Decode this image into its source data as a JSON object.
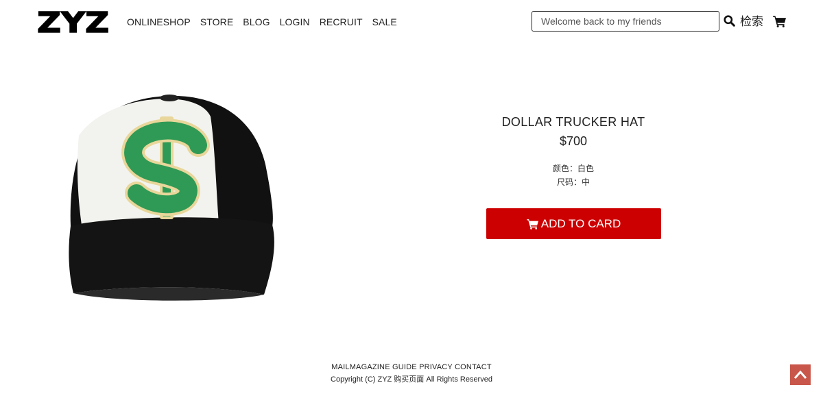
{
  "header": {
    "logo": "ZYZ",
    "nav": [
      "ONLINESHOP",
      "STORE",
      "BLOG",
      "LOGIN",
      "RECRUIT",
      "SALE"
    ],
    "search": {
      "placeholder": "Welcome back to my friends",
      "button_label": "检索"
    }
  },
  "product": {
    "title": "DOLLAR TRUCKER HAT",
    "price": "$700",
    "color": "颜色：白色",
    "size": "尺码：中",
    "add_button": "ADD TO CARD"
  },
  "footer": {
    "links": "MAILMAGAZINE GUIDE PRIVACY CONTACT",
    "copyright": "Copyright (C) ZYZ 购买页面 All Rights Reserved"
  },
  "colors": {
    "accent": "#cc0000",
    "back_top": "#c0392b"
  },
  "icons": [
    "search-icon",
    "cart-icon",
    "back-to-top-icon"
  ]
}
